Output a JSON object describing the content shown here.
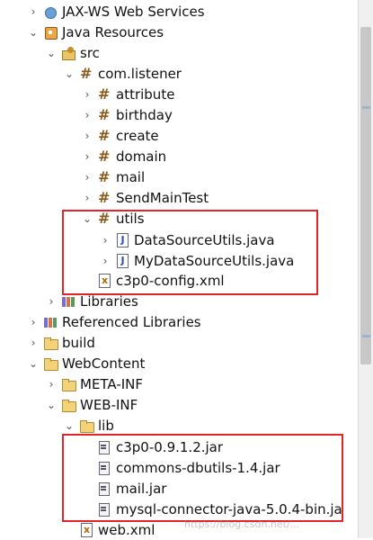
{
  "tree": [
    {
      "label": "JAX-WS Web Services",
      "icon": "web-services-icon",
      "toggle": "›"
    },
    {
      "label": "Java Resources",
      "icon": "java-resources-icon",
      "toggle": "⌄"
    },
    {
      "label": "src",
      "icon": "source-folder-icon",
      "toggle": "⌄"
    },
    {
      "label": "com.listener",
      "icon": "package-icon",
      "toggle": "⌄"
    },
    {
      "label": "attribute",
      "icon": "package-icon",
      "toggle": "›"
    },
    {
      "label": "birthday",
      "icon": "package-icon",
      "toggle": "›"
    },
    {
      "label": "create",
      "icon": "package-icon",
      "toggle": "›"
    },
    {
      "label": "domain",
      "icon": "package-icon",
      "toggle": "›"
    },
    {
      "label": "mail",
      "icon": "package-icon",
      "toggle": "›"
    },
    {
      "label": "SendMainTest",
      "icon": "package-icon",
      "toggle": "›"
    },
    {
      "label": "utils",
      "icon": "package-icon",
      "toggle": "⌄"
    },
    {
      "label": "DataSourceUtils.java",
      "icon": "java-file-icon",
      "toggle": "›"
    },
    {
      "label": "MyDataSourceUtils.java",
      "icon": "java-file-icon",
      "toggle": "›"
    },
    {
      "label": "c3p0-config.xml",
      "icon": "xml-file-icon",
      "toggle": ""
    },
    {
      "label": "Libraries",
      "icon": "libraries-icon",
      "toggle": "›"
    },
    {
      "label": "Referenced Libraries",
      "icon": "libraries-icon",
      "toggle": "›"
    },
    {
      "label": "build",
      "icon": "folder-icon",
      "toggle": "›"
    },
    {
      "label": "WebContent",
      "icon": "folder-icon",
      "toggle": "⌄"
    },
    {
      "label": "META-INF",
      "icon": "folder-icon",
      "toggle": "›"
    },
    {
      "label": "WEB-INF",
      "icon": "folder-icon",
      "toggle": "⌄"
    },
    {
      "label": "lib",
      "icon": "folder-icon",
      "toggle": "⌄"
    },
    {
      "label": "c3p0-0.9.1.2.jar",
      "icon": "jar-file-icon",
      "toggle": ""
    },
    {
      "label": "commons-dbutils-1.4.jar",
      "icon": "jar-file-icon",
      "toggle": ""
    },
    {
      "label": "mail.jar",
      "icon": "jar-file-icon",
      "toggle": ""
    },
    {
      "label": "mysql-connector-java-5.0.4-bin.ja",
      "icon": "jar-file-icon",
      "toggle": ""
    },
    {
      "label": "web.xml",
      "icon": "xml-file-icon",
      "toggle": ""
    }
  ],
  "highlight_color": "#e0262b",
  "watermark": "https://blog.csdn.net/..."
}
